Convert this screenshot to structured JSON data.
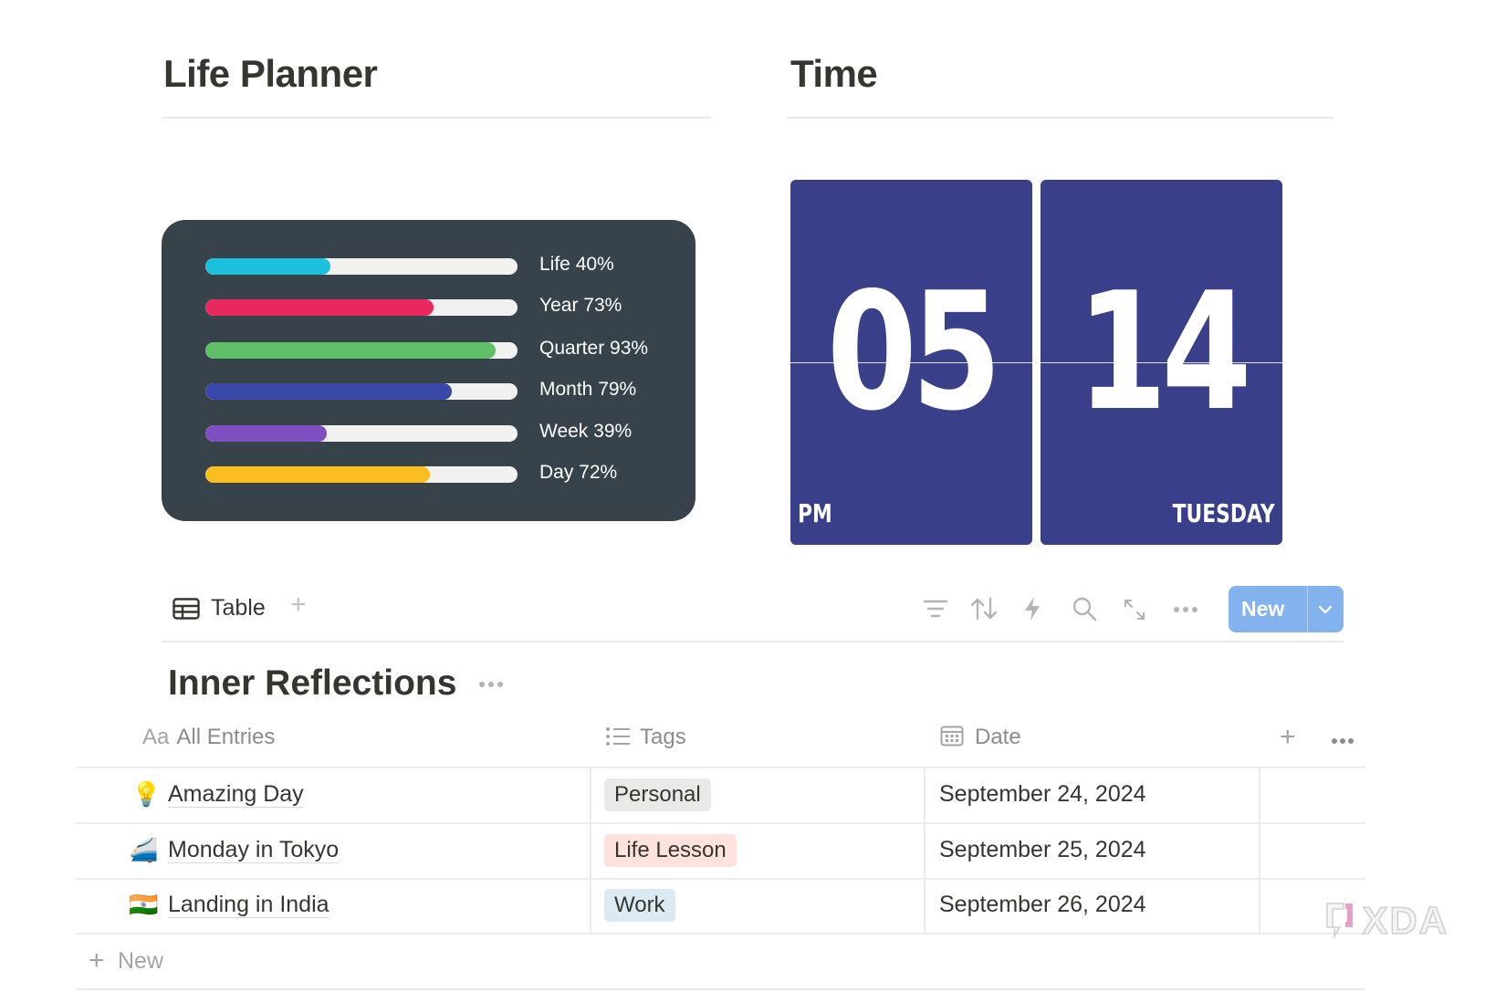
{
  "headings": {
    "life_planner": "Life Planner",
    "time": "Time"
  },
  "progress": [
    {
      "label": "Life 40%",
      "value": 40,
      "color": "#1bc0dd"
    },
    {
      "label": "Year 73%",
      "value": 73,
      "color": "#e8285f"
    },
    {
      "label": "Quarter 93%",
      "value": 93,
      "color": "#5fbf69"
    },
    {
      "label": "Month 79%",
      "value": 79,
      "color": "#3a48a8"
    },
    {
      "label": "Week 39%",
      "value": 39,
      "color": "#7d4fc1"
    },
    {
      "label": "Day 72%",
      "value": 72,
      "color": "#fbbd20"
    }
  ],
  "clock": {
    "hour": "05",
    "minute": "14",
    "period": "PM",
    "day": "TUESDAY",
    "color": "#3a3f8a"
  },
  "toolbar": {
    "view_label": "Table",
    "view_icon": "table-icon",
    "icons": [
      "filter-icon",
      "sort-icon",
      "automation-icon",
      "search-icon",
      "expand-icon",
      "more-icon"
    ],
    "new_label": "New"
  },
  "database": {
    "title": "Inner Reflections",
    "columns": {
      "entries": "All Entries",
      "entries_prefix": "Aa",
      "tags": "Tags",
      "date": "Date"
    },
    "rows": [
      {
        "emoji": "💡",
        "title": "Amazing Day",
        "tag": "Personal",
        "tag_color": "#e9e9e7",
        "date": "September 24, 2024"
      },
      {
        "emoji": "🚄",
        "title": "Monday in Tokyo",
        "tag": "Life Lesson",
        "tag_color": "#fde2dd",
        "date": "September 25, 2024"
      },
      {
        "emoji": "🇮🇳",
        "title": "Landing in India",
        "tag": "Work",
        "tag_color": "#dbe9f3",
        "date": "September 26, 2024"
      }
    ],
    "new_row_label": "New"
  },
  "watermark": "XDA"
}
